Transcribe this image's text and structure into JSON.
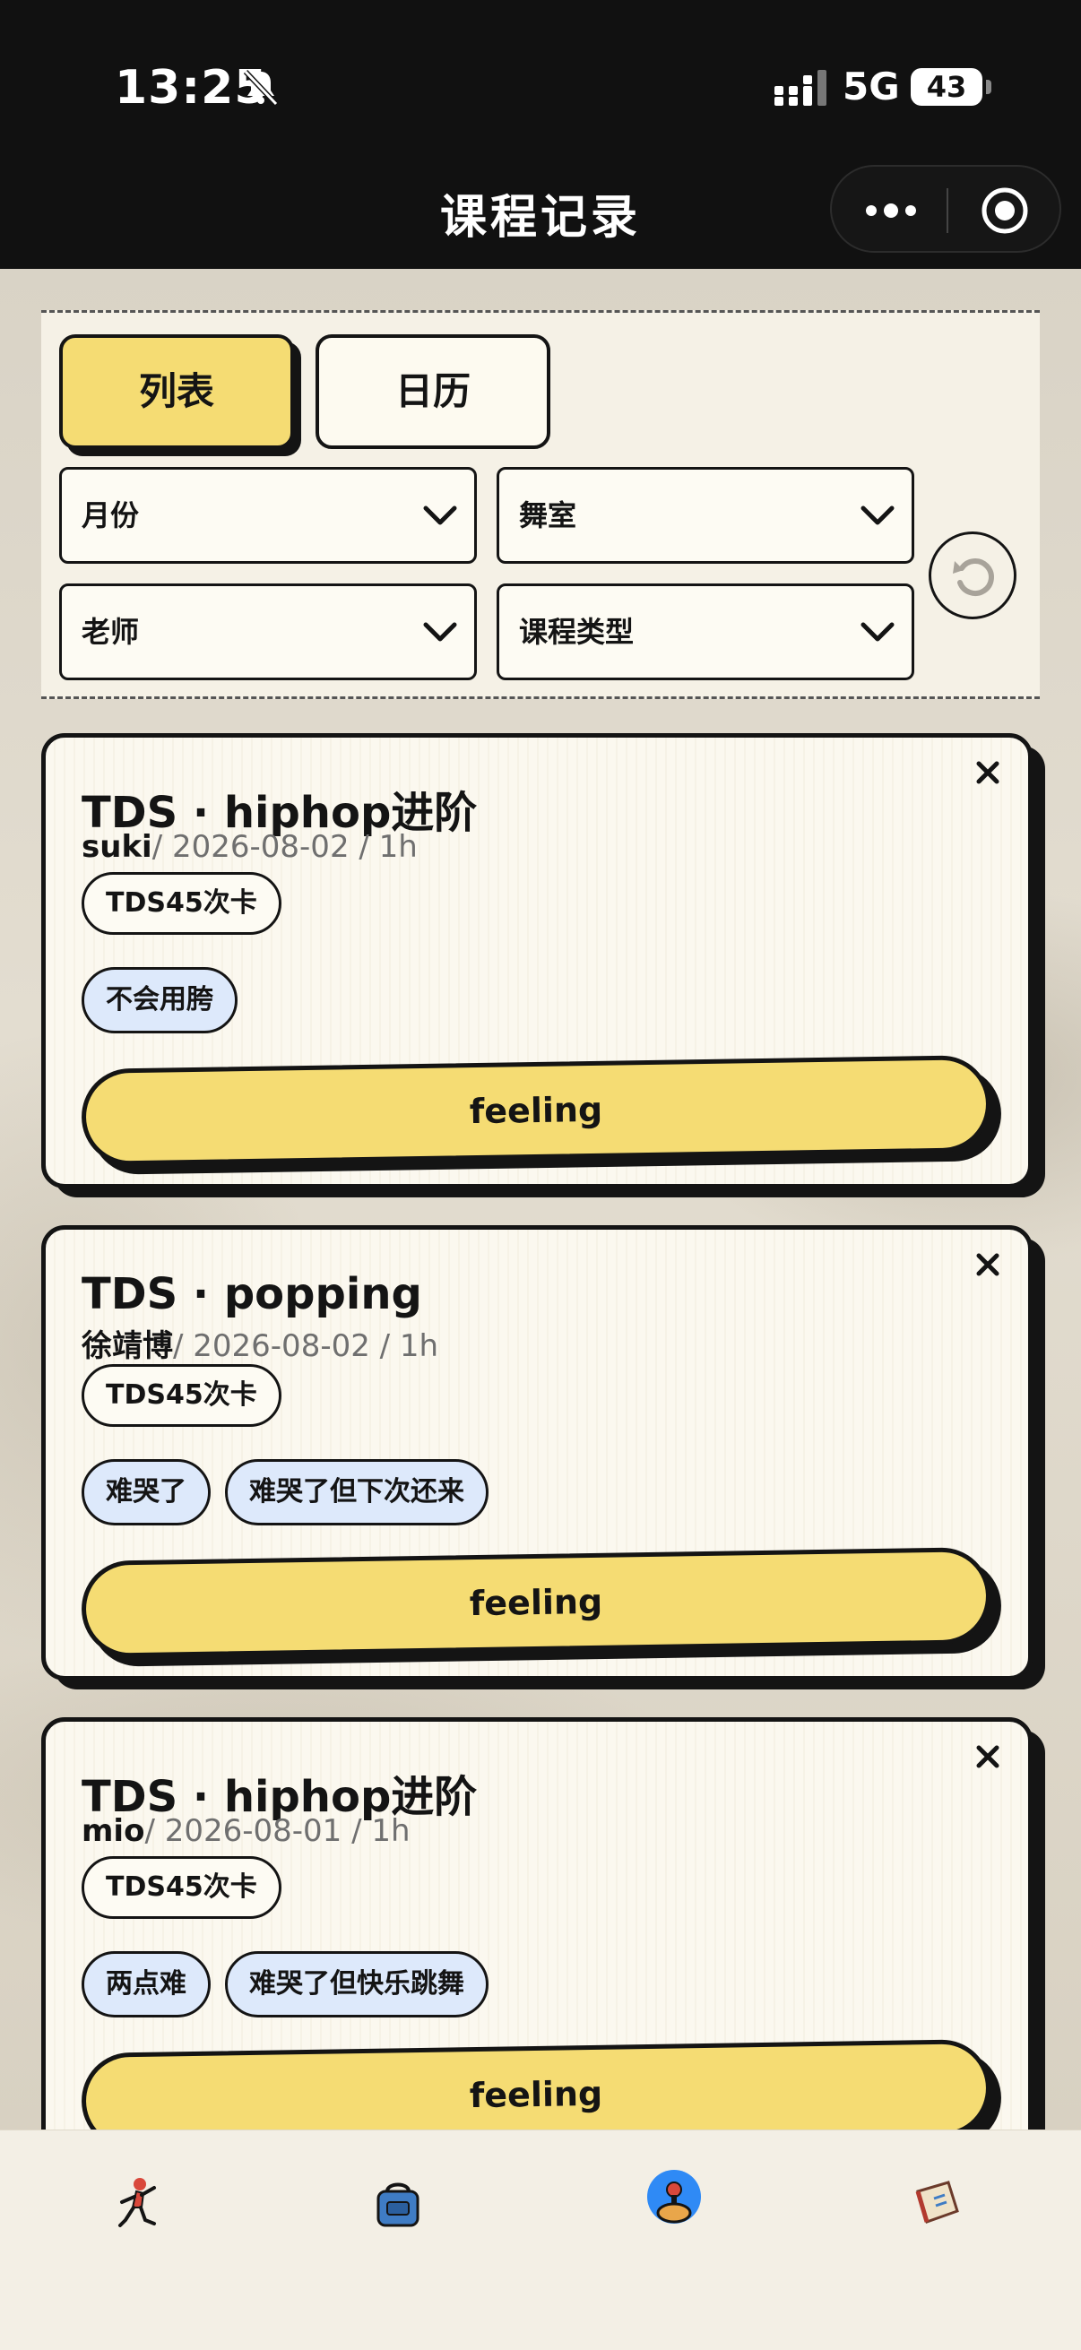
{
  "status_bar": {
    "time": "13:25",
    "network": "5G",
    "battery": "43"
  },
  "nav": {
    "title": "课程记录"
  },
  "view_tabs": {
    "list": "列表",
    "calendar": "日历",
    "active": "list"
  },
  "filters": {
    "month": "月份",
    "studio": "舞室",
    "teacher": "老师",
    "course_type": "课程类型"
  },
  "records": [
    {
      "title": "TDS · hiphop进阶",
      "teacher": "suki",
      "detail": "/ 2026-08-02 / 1h",
      "card": "TDS45次卡",
      "moods": [
        "不会用胯"
      ],
      "feeling_label": "feeling"
    },
    {
      "title": "TDS · popping",
      "teacher": "徐靖博",
      "detail": "/ 2026-08-02 / 1h",
      "card": "TDS45次卡",
      "moods": [
        "难哭了",
        "难哭了但下次还来"
      ],
      "feeling_label": "feeling"
    },
    {
      "title": "TDS · hiphop进阶",
      "teacher": "mio",
      "detail": "/ 2026-08-01 / 1h",
      "card": "TDS45次卡",
      "moods": [
        "两点难",
        "难哭了但快乐跳舞"
      ],
      "feeling_label": "feeling"
    }
  ],
  "tabbar": {
    "items": [
      {
        "icon": "dancer-icon"
      },
      {
        "icon": "bag-icon"
      },
      {
        "icon": "joystick-icon",
        "active": true
      },
      {
        "icon": "book-icon"
      }
    ]
  },
  "colors": {
    "accent_yellow": "#f5dc73",
    "mood_blue": "#dde9fb",
    "ink": "#141414",
    "card_bg": "#fbf8ef",
    "active_tab_blue": "#2f8af5"
  }
}
